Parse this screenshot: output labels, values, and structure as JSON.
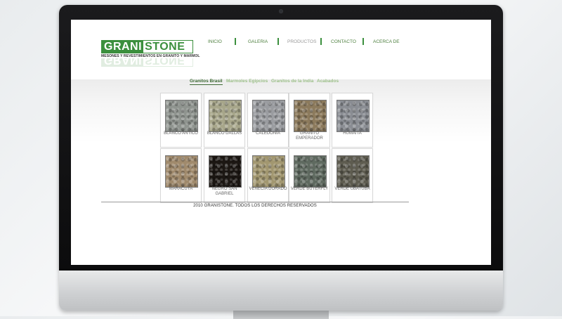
{
  "logo": {
    "part1": "GRANI",
    "part2": "STONE",
    "tagline": "MESONES Y REVESTIMIENTOS EN GRANITO Y MARMOL"
  },
  "nav": [
    "INICIO",
    "GALERIA",
    "PRODUCTOS",
    "CONTACTO",
    "ACERCA DE"
  ],
  "nav_active": "PRODUCTOS",
  "subtabs": [
    "Granitos Brasil",
    "Marmoles Egipcios",
    "Granitos de la India",
    "Acabados"
  ],
  "subtab_active": "Granitos Brasil",
  "products": [
    {
      "name": "BLANCO ANTICO",
      "color": "#8f948f"
    },
    {
      "name": "BLANCO DALLAS",
      "color": "#a7a68a"
    },
    {
      "name": "CALEDONIA",
      "color": "#9a9ca0"
    },
    {
      "name": "GRANITO EMPERADOR",
      "color": "#8c7a5c"
    },
    {
      "name": "HUMAITA",
      "color": "#8a8d93"
    },
    {
      "name": "MARACUYA",
      "color": "#a08a6c"
    },
    {
      "name": "NEGRO SAN GABRIEL",
      "color": "#1c1713"
    },
    {
      "name": "VENECIA DORADO",
      "color": "#a29770"
    },
    {
      "name": "VERDE BUTERFLY",
      "color": "#5f6a60"
    },
    {
      "name": "VERDE UBATUBA",
      "color": "#5e5c50"
    }
  ],
  "footer": "2010 GRANISTONE.  TODOS LOS DERECHOS RESERVADOS",
  "colors": {
    "brand_green": "#3b8f3d",
    "subtab_inactive": "#9dc08a"
  }
}
